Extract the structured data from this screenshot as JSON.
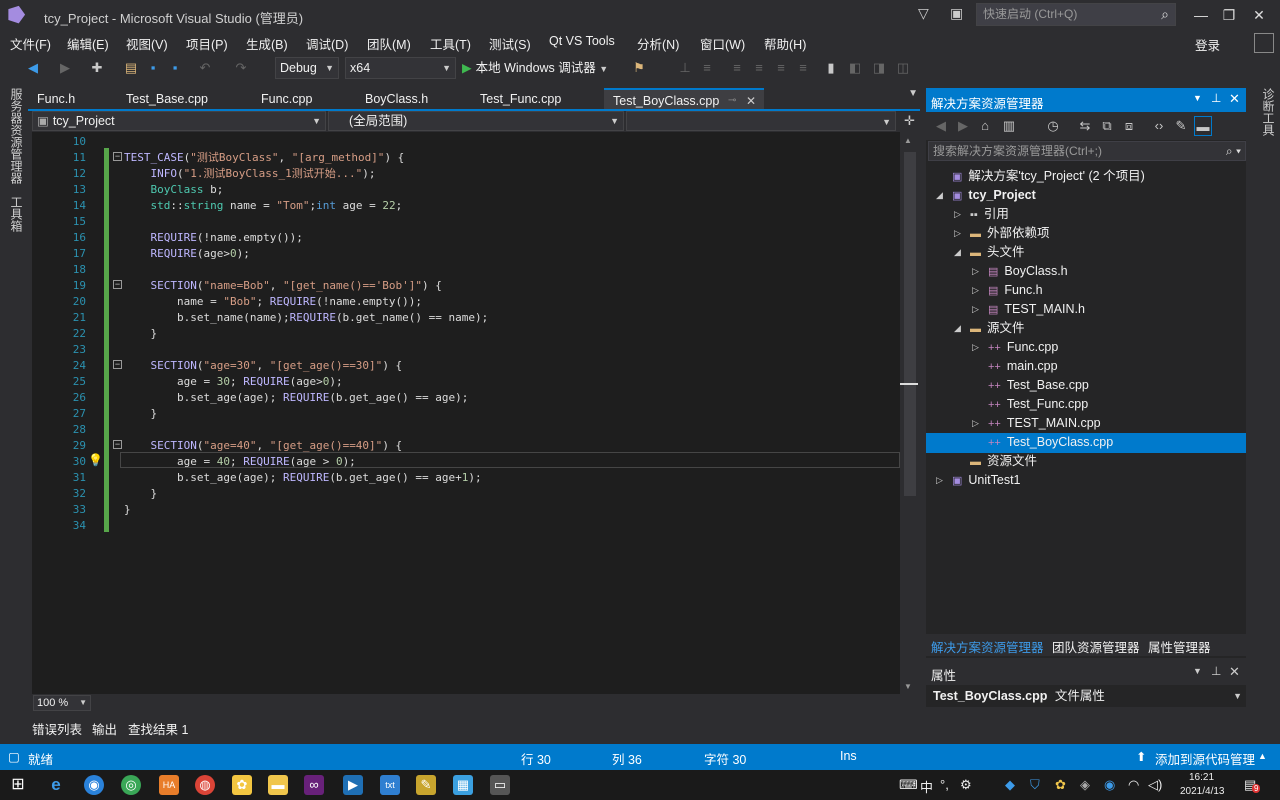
{
  "window": {
    "title": "tcy_Project - Microsoft Visual Studio (管理员)",
    "quick_launch_placeholder": "快速启动 (Ctrl+Q)",
    "login": "登录"
  },
  "menu": [
    "文件(F)",
    "编辑(E)",
    "视图(V)",
    "项目(P)",
    "生成(B)",
    "调试(D)",
    "团队(M)",
    "工具(T)",
    "测试(S)",
    "Qt VS Tools",
    "分析(N)",
    "窗口(W)",
    "帮助(H)"
  ],
  "toolbar": {
    "config": "Debug",
    "platform": "x64",
    "run_label": "本地 Windows 调试器"
  },
  "left_strip": {
    "server_explorer": "服务器资源管理器",
    "toolbox": "工具箱"
  },
  "right_strip": {
    "diagnostic_tools": "诊断工具"
  },
  "tabs": [
    "Func.h",
    "Test_Base.cpp",
    "Func.cpp",
    "BoyClass.h",
    "Test_Func.cpp",
    "Test_BoyClass.cpp"
  ],
  "nav": {
    "project": "tcy_Project",
    "scope": "(全局范围)"
  },
  "code": {
    "line_numbers": [
      "10",
      "11",
      "12",
      "13",
      "14",
      "15",
      "16",
      "17",
      "18",
      "19",
      "20",
      "21",
      "22",
      "23",
      "24",
      "25",
      "26",
      "27",
      "28",
      "29",
      "30",
      "31",
      "32",
      "33",
      "34"
    ],
    "lines": [
      "",
      "TEST_CASE(\"测试BoyClass\", \"[arg_method]\") {",
      "    INFO(\"1.测试BoyClass_1测试开始...\");",
      "    BoyClass b;",
      "    std::string name = \"Tom\";int age = 22;",
      "",
      "    REQUIRE(!name.empty());",
      "    REQUIRE(age>0);",
      "",
      "    SECTION(\"name=Bob\", \"[get_name()=='Bob']\") {",
      "        name = \"Bob\"; REQUIRE(!name.empty());",
      "        b.set_name(name);REQUIRE(b.get_name() == name);",
      "    }",
      "",
      "    SECTION(\"age=30\", \"[get_age()==30]\") {",
      "        age = 30; REQUIRE(age>0);",
      "        b.set_age(age); REQUIRE(b.get_age() == age);",
      "    }",
      "",
      "    SECTION(\"age=40\", \"[get_age()==40]\") {",
      "        age = 40; REQUIRE(age > 0);",
      "        b.set_age(age); REQUIRE(b.get_age() == age+1);",
      "    }",
      "}",
      ""
    ]
  },
  "zoom": "100 %",
  "bottom_tabs": [
    "错误列表",
    "输出",
    "查找结果 1"
  ],
  "solution_explorer": {
    "title": "解决方案资源管理器",
    "search_placeholder": "搜索解决方案资源管理器(Ctrl+;)",
    "items": [
      {
        "label": "解决方案'tcy_Project' (2 个项目)",
        "icon": "solution-icon",
        "expander": ""
      },
      {
        "label": "tcy_Project",
        "icon": "project-icon",
        "expander": "▲"
      },
      {
        "label": "引用",
        "icon": "references-icon",
        "expander": "▷"
      },
      {
        "label": "外部依赖项",
        "icon": "folder-icon",
        "expander": "▷"
      },
      {
        "label": "头文件",
        "icon": "folder-icon",
        "expander": "▲"
      },
      {
        "label": "BoyClass.h",
        "icon": "header-file-icon",
        "expander": "▷"
      },
      {
        "label": "Func.h",
        "icon": "header-file-icon",
        "expander": "▷"
      },
      {
        "label": "TEST_MAIN.h",
        "icon": "header-file-icon",
        "expander": "▷"
      },
      {
        "label": "源文件",
        "icon": "folder-icon",
        "expander": "▲"
      },
      {
        "label": "Func.cpp",
        "icon": "cpp-file-icon",
        "expander": "▷"
      },
      {
        "label": "main.cpp",
        "icon": "cpp-file-icon",
        "expander": ""
      },
      {
        "label": "Test_Base.cpp",
        "icon": "cpp-file-icon",
        "expander": ""
      },
      {
        "label": "Test_Func.cpp",
        "icon": "cpp-file-icon",
        "expander": ""
      },
      {
        "label": "TEST_MAIN.cpp",
        "icon": "cpp-file-icon",
        "expander": "▷"
      },
      {
        "label": "Test_BoyClass.cpp",
        "icon": "cpp-file-icon",
        "expander": ""
      },
      {
        "label": "资源文件",
        "icon": "folder-icon",
        "expander": ""
      },
      {
        "label": "UnitTest1",
        "icon": "project-icon",
        "expander": "▷"
      }
    ],
    "bottom_tabs": [
      "解决方案资源管理器",
      "团队资源管理器",
      "属性管理器"
    ]
  },
  "properties": {
    "title": "属性",
    "selected_file": "Test_BoyClass.cpp",
    "selected_type": "文件属性"
  },
  "status": {
    "ready": "就绪",
    "line": "行 30",
    "col": "列 36",
    "char": "字符 30",
    "mode": "Ins",
    "source_control": "添加到源代码管理"
  },
  "taskbar": {
    "time": "16:21",
    "date": "2021/4/13",
    "ime": "中",
    "badge": "9"
  },
  "colors": {
    "accent": "#007acc",
    "keyword": "#569cd6",
    "string": "#d69d85",
    "macro": "#beb7ff",
    "type": "#4ec9b0",
    "number": "#b5cea8"
  }
}
